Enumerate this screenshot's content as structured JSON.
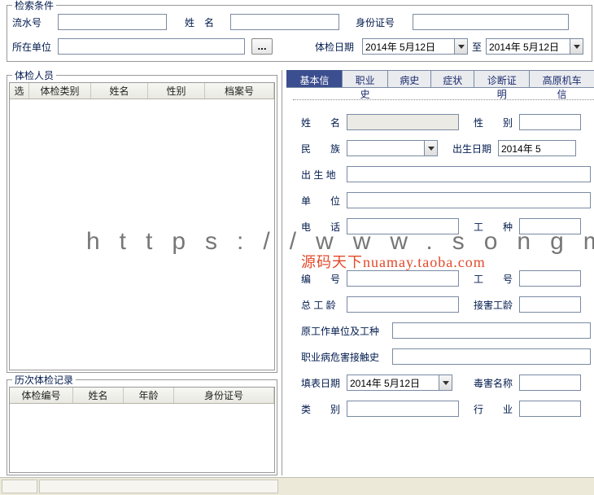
{
  "search": {
    "group_label": "检索条件",
    "serial_label": "流水号",
    "name_label": "姓　名",
    "id_label": "身份证号",
    "org_label": "所在单位",
    "date_label": "体检日期",
    "date_to": "至",
    "date_from_value": "2014年 5月12日",
    "date_to_value": "2014年 5月12日",
    "ellipsis": "..."
  },
  "roster": {
    "group_label": "体检人员",
    "cols": {
      "sel": "选",
      "type": "体检类别",
      "name": "姓名",
      "sex": "性别",
      "file": "档案号"
    }
  },
  "history": {
    "group_label": "历次体检记录",
    "cols": {
      "no": "体检编号",
      "name": "姓名",
      "age": "年龄",
      "id": "身份证号"
    }
  },
  "tabs": {
    "basic": "基本信息",
    "job": "职业史",
    "illness": "病史",
    "symptom": "症状",
    "diag": "诊断证明",
    "high": "高原机车信"
  },
  "form": {
    "name": "姓　　名",
    "sex": "性　　别",
    "ethnic": "民　　族",
    "birth": "出生日期",
    "birth_value": "2014年 5",
    "birthplace": "出 生 地",
    "org": "单　　位",
    "phone": "电　　话",
    "jobtype": "工　　种",
    "code": "编　　号",
    "workno": "工　　号",
    "total_age": "总 工 龄",
    "exposure_age": "接害工龄",
    "prev_org": "原工作单位及工种",
    "hazard_hist": "职业病危害接触史",
    "fill_date": "填表日期",
    "fill_date_value": "2014年 5月12日",
    "toxic_name": "毒害名称",
    "category": "类　　别",
    "industry": "行　　业"
  },
  "watermark": {
    "url": "https://www.songma.com",
    "shop": "源码天下nuamay.taoba.com"
  }
}
